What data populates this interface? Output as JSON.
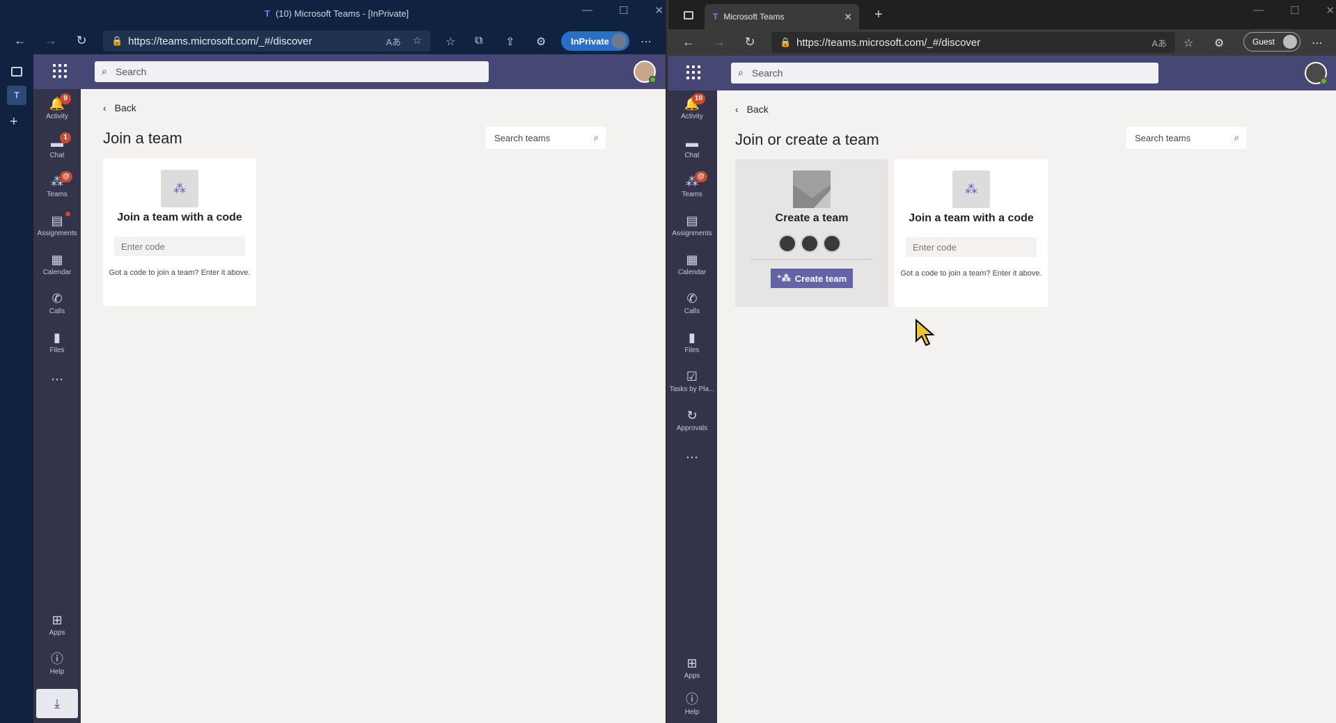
{
  "left_window": {
    "title": "(10) Microsoft Teams - [InPrivate]",
    "url": "https://teams.microsoft.com/_#/discover",
    "inprivate_label": "InPrivate",
    "search_placeholder": "Search",
    "rail": [
      {
        "label": "Activity",
        "icon": "bell-icon",
        "badge": "9"
      },
      {
        "label": "Chat",
        "icon": "chat-icon",
        "badge": "1"
      },
      {
        "label": "Teams",
        "icon": "teams-icon",
        "badge": "@"
      },
      {
        "label": "Assignments",
        "icon": "assignments-icon"
      },
      {
        "label": "Calendar",
        "icon": "calendar-icon"
      },
      {
        "label": "Calls",
        "icon": "phone-icon"
      },
      {
        "label": "Files",
        "icon": "file-icon"
      }
    ],
    "rail_bottom": [
      {
        "label": "Apps",
        "icon": "apps-icon"
      },
      {
        "label": "Help",
        "icon": "help-icon"
      }
    ],
    "back_label": "Back",
    "page_title": "Join a team",
    "search_teams_placeholder": "Search teams",
    "join_card": {
      "title": "Join a team with a code",
      "code_placeholder": "Enter code",
      "hint": "Got a code to join a team? Enter it above."
    }
  },
  "right_window": {
    "tab_title": "Microsoft Teams",
    "url": "https://teams.microsoft.com/_#/discover",
    "guest_label": "Guest",
    "search_placeholder": "Search",
    "rail": [
      {
        "label": "Activity",
        "icon": "bell-icon",
        "badge": "10"
      },
      {
        "label": "Chat",
        "icon": "chat-icon"
      },
      {
        "label": "Teams",
        "icon": "teams-icon",
        "badge": "@"
      },
      {
        "label": "Assignments",
        "icon": "assignments-icon"
      },
      {
        "label": "Calendar",
        "icon": "calendar-icon"
      },
      {
        "label": "Calls",
        "icon": "phone-icon"
      },
      {
        "label": "Files",
        "icon": "file-icon"
      },
      {
        "label": "Tasks by Pla...",
        "icon": "tasks-icon"
      },
      {
        "label": "Approvals",
        "icon": "approvals-icon"
      }
    ],
    "rail_bottom": [
      {
        "label": "Apps",
        "icon": "apps-icon"
      },
      {
        "label": "Help",
        "icon": "help-icon"
      }
    ],
    "back_label": "Back",
    "page_title": "Join or create a team",
    "search_teams_placeholder": "Search teams",
    "create_card": {
      "title": "Create a team",
      "button_label": "Create team"
    },
    "join_card": {
      "title": "Join a team with a code",
      "code_placeholder": "Enter code",
      "hint": "Got a code to join a team? Enter it above."
    }
  },
  "colors": {
    "teams_purple": "#464775",
    "rail_bg": "#33344a",
    "accent": "#6264a7",
    "badge": "#cc4a31",
    "inprivate_blue": "#2a6fc7"
  }
}
